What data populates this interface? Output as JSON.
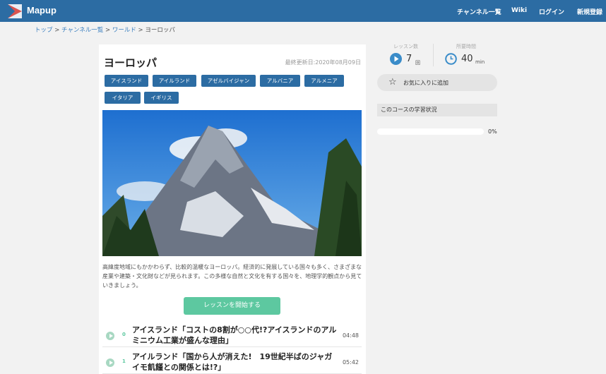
{
  "header": {
    "brand": "Mapup",
    "nav": [
      "チャンネル一覧",
      "Wiki",
      "ログイン",
      "新規登録"
    ]
  },
  "breadcrumb": {
    "items": [
      "トップ",
      "チャンネル一覧",
      "ワールド"
    ],
    "separator": ">",
    "current": "ヨーロッパ"
  },
  "course": {
    "title": "ヨーロッパ",
    "updated": "最終更新日:2020年08月09日",
    "tags": [
      "アイスランド",
      "アイルランド",
      "アゼルバイジャン",
      "アルバニア",
      "アルメニア",
      "イタリア",
      "イギリス"
    ],
    "image_alt": "mountain-peak-photo",
    "description": "高緯度地域にもかかわらず、比較的温暖なヨーロッパ。経済的に発展している国々も多く、さまざまな産業や建築・文化財などが見られます。この多様な自然と文化を有する国々を、地理学的観点から見ていきましょう。",
    "start_button": "レッスンを開始する",
    "lessons": [
      {
        "num": "0",
        "title": "アイスランド「コストの8割が○○代!?アイスランドのアルミニウム工業が盛んな理由」",
        "duration": "04:48"
      },
      {
        "num": "1",
        "title": "アイルランド「国から人が消えた!　19世紀半ばのジャガイモ飢饉との関係とは!?」",
        "duration": "05:42"
      }
    ]
  },
  "sidebar": {
    "lesson_count_label": "レッスン数",
    "lesson_count": "7",
    "lesson_count_unit": "回",
    "duration_label": "所要時間",
    "duration": "40",
    "duration_unit": "min",
    "favorite_button": "お気に入りに追加",
    "status_heading": "このコースの学習状況",
    "progress_percent": 0,
    "progress_text": "0%"
  },
  "colors": {
    "brand_blue": "#2c6ca3",
    "accent_green": "#5dc8a0",
    "icon_blue": "#3a8cc9"
  }
}
